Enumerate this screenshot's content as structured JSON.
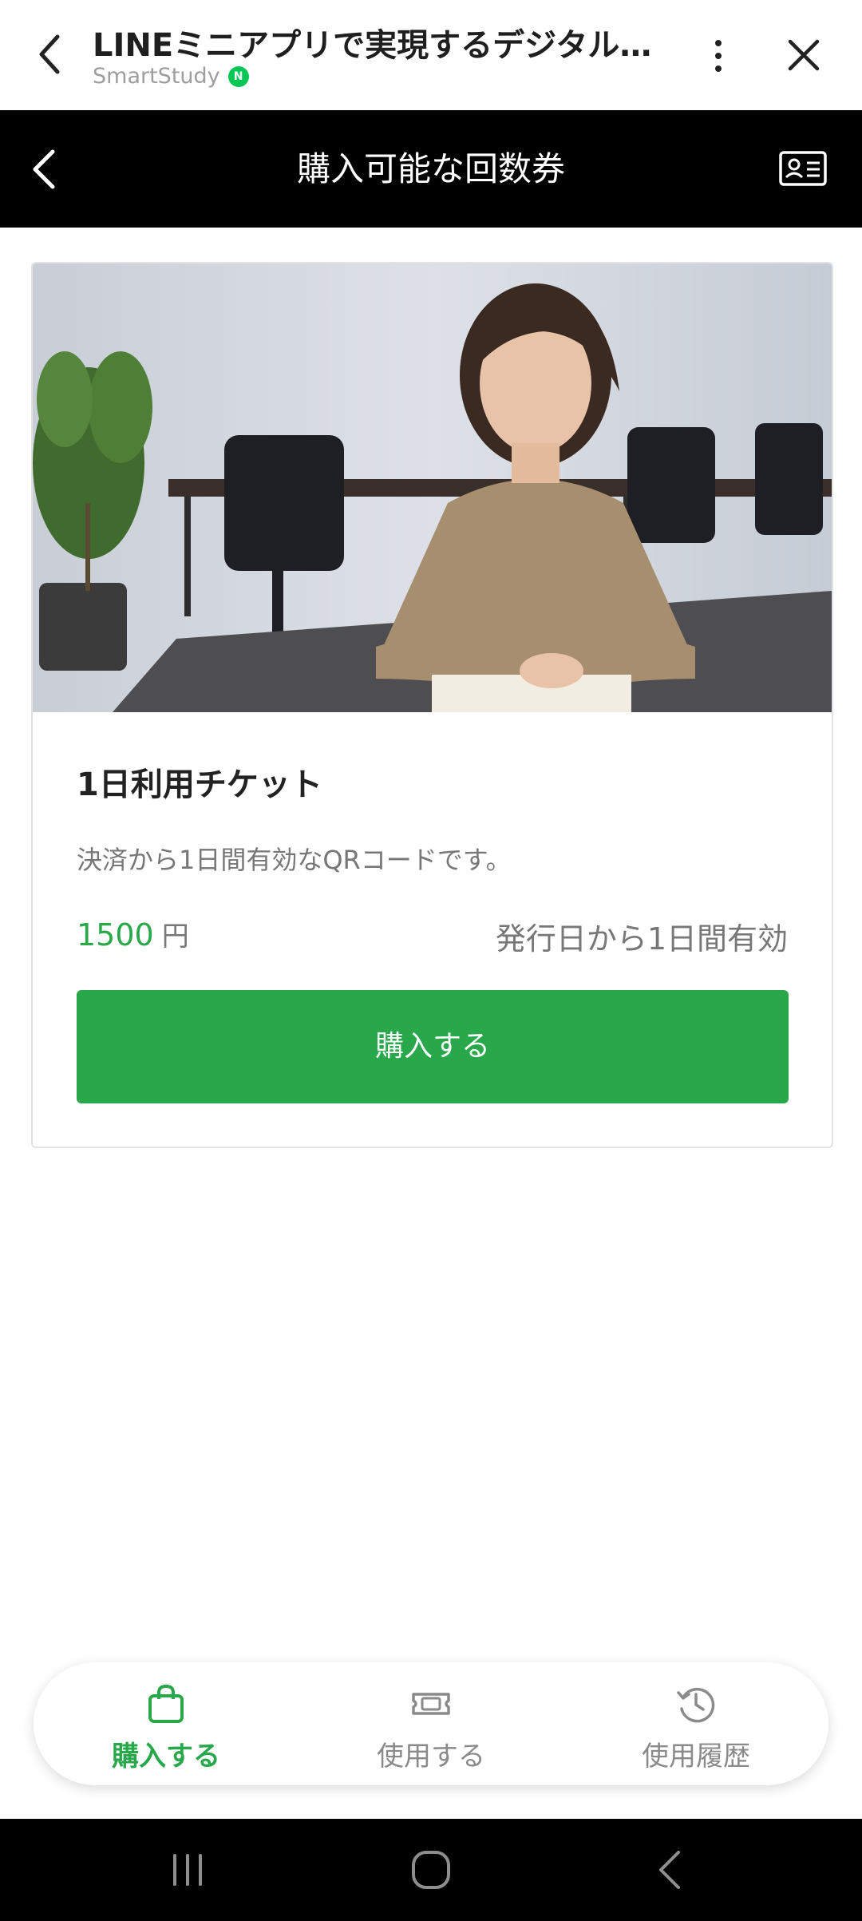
{
  "liff_header": {
    "title": "LINEミニアプリで実現するデジタル…",
    "provider": "SmartStudy",
    "verified_badge": "N"
  },
  "app_bar": {
    "title": "購入可能な回数券"
  },
  "ticket": {
    "name": "1日利用チケット",
    "description": "決済から1日間有効なQRコードです。",
    "price": "1500",
    "price_unit": "円",
    "validity": "発行日から1日間有効",
    "buy_label": "購入する"
  },
  "bottom_nav": {
    "items": [
      {
        "label": "購入する",
        "icon": "shopping-bag-icon",
        "active": true
      },
      {
        "label": "使用する",
        "icon": "ticket-icon",
        "active": false
      },
      {
        "label": "使用履歴",
        "icon": "history-icon",
        "active": false
      }
    ]
  },
  "colors": {
    "accent": "#28a84a",
    "app_bar_bg": "#000000",
    "verified": "#06c755"
  }
}
